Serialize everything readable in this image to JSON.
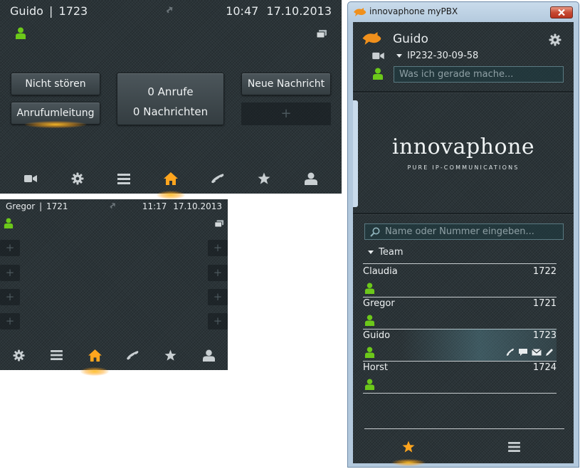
{
  "phone1": {
    "user_name": "Guido",
    "separator": "|",
    "extension": "1723",
    "time": "10:47",
    "date": "17.10.2013",
    "buttons": {
      "dnd_label": "Nicht stören",
      "forward_label": "Anrufumleitung",
      "calls_label": "0 Anrufe",
      "messages_label": "0 Nachrichten",
      "new_message_label": "Neue Nachricht",
      "empty_label": "+"
    },
    "nav": [
      "video-icon",
      "gear-icon",
      "menu-icon",
      "home-icon",
      "phone-icon",
      "star-icon",
      "person-icon"
    ],
    "active_nav": "home-icon"
  },
  "phone2": {
    "user_name": "Gregor",
    "separator": "|",
    "extension": "1721",
    "time": "11:17",
    "date": "17.10.2013",
    "empty_label": "+",
    "nav": [
      "gear-icon",
      "menu-icon",
      "home-icon",
      "phone-icon",
      "star-icon",
      "person-icon"
    ],
    "active_nav": "home-icon"
  },
  "window": {
    "title": "innovaphone myPBX",
    "user_name": "Guido",
    "device": "IP232-30-09-58",
    "status_placeholder": "Was ich gerade mache...",
    "logo_text": "innovaphone",
    "logo_tagline": "PURE IP-COMMUNICATIONS",
    "search_placeholder": "Name oder Nummer eingeben...",
    "group_label": "Team",
    "contacts": [
      {
        "name": "Claudia",
        "number": "1722"
      },
      {
        "name": "Gregor",
        "number": "1721"
      },
      {
        "name": "Guido",
        "number": "1723"
      },
      {
        "name": "Horst",
        "number": "1724"
      }
    ],
    "bottom_tabs": [
      "star-icon",
      "menu-icon"
    ]
  },
  "colors": {
    "presence_green": "#6cc81a",
    "accent_orange": "#ffa51e",
    "panel_bg": "#2b3438",
    "window_frame": "#b3c9dd"
  }
}
